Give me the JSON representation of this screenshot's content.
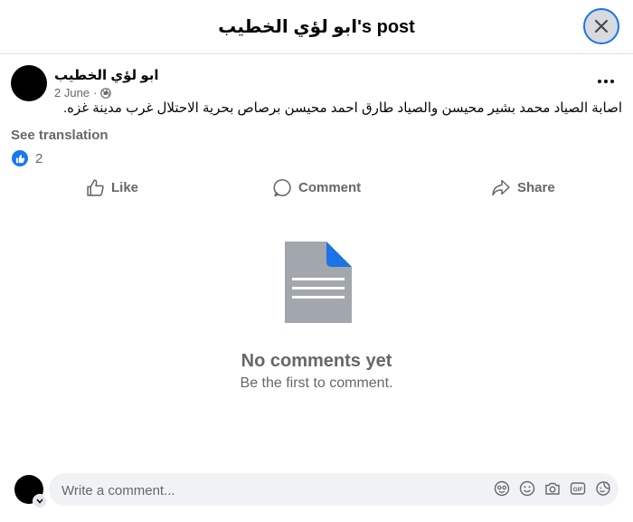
{
  "dialog": {
    "title": "ابو لؤي الخطيب's post"
  },
  "post": {
    "author": "ابو لؤي الخطيب",
    "date": "2 June",
    "separator": "·",
    "audience_icon": "globe-icon",
    "text": "اصابة الصياد محمد بشير محيسن والصياد طارق احمد محيسن برصاص بحرية الاحتلال غرب مدينة غزه.",
    "see_translation": "See translation",
    "reaction_count": "2"
  },
  "actions": {
    "like": "Like",
    "comment": "Comment",
    "share": "Share"
  },
  "empty_state": {
    "title": "No comments yet",
    "subtitle": "Be the first to comment."
  },
  "composer": {
    "placeholder": "Write a comment...",
    "icons": [
      "avatar-sticker-icon",
      "emoji-icon",
      "camera-icon",
      "gif-icon",
      "sticker-icon"
    ]
  },
  "colors": {
    "accent": "#1877f2",
    "secondary_text": "#65676b",
    "focus_ring": "#1b74e4",
    "doc_gray": "#a2a6ad",
    "doc_corner": "#1b74e4"
  }
}
